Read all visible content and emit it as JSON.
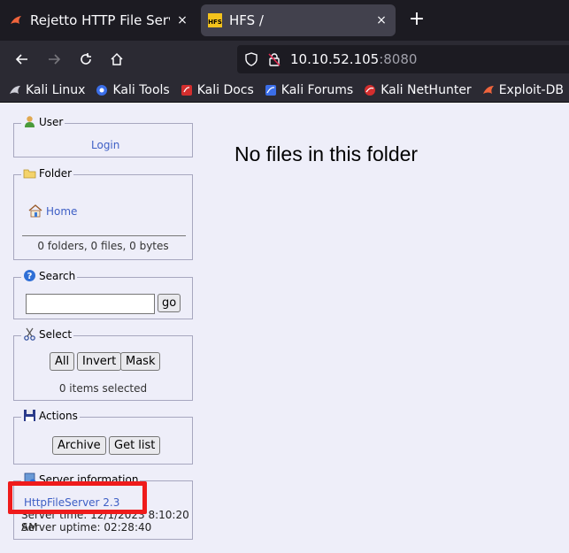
{
  "browser": {
    "tabs": [
      {
        "title": "Rejetto HTTP File Server (",
        "active": false,
        "close": "×"
      },
      {
        "title": "HFS /",
        "active": true,
        "close": "×"
      }
    ],
    "new_tab": "+",
    "url": {
      "host": "10.10.52.105",
      "port": ":8080"
    },
    "bookmarks": [
      {
        "label": "Kali Linux",
        "icon": "kali-dragon-icon"
      },
      {
        "label": "Kali Tools",
        "icon": "kali-tools-icon"
      },
      {
        "label": "Kali Docs",
        "icon": "kali-docs-icon"
      },
      {
        "label": "Kali Forums",
        "icon": "kali-forums-icon"
      },
      {
        "label": "Kali NetHunter",
        "icon": "nethunter-icon"
      },
      {
        "label": "Exploit-DB",
        "icon": "exploitdb-icon"
      }
    ]
  },
  "sidebar": {
    "user": {
      "legend": "User",
      "login": "Login"
    },
    "folder": {
      "legend": "Folder",
      "home": "Home",
      "summary": "0 folders, 0 files, 0 bytes"
    },
    "search": {
      "legend": "Search",
      "go": "go",
      "value": ""
    },
    "select": {
      "legend": "Select",
      "all": "All",
      "invert": "Invert",
      "mask": "Mask",
      "status": "0 items selected"
    },
    "actions": {
      "legend": "Actions",
      "archive": "Archive",
      "get_list": "Get list"
    },
    "server_info": {
      "legend": "Server information",
      "version": "HttpFileServer 2.3",
      "server_time": "Server time: 12/1/2023 8:10:20 AM",
      "server_uptime": "Server uptime: 02:28:40"
    }
  },
  "main": {
    "message": "No files in this folder"
  },
  "colors": {
    "link": "#3e5fc5",
    "highlight": "#ef1b1b",
    "page_bg": "#eeeef9"
  }
}
